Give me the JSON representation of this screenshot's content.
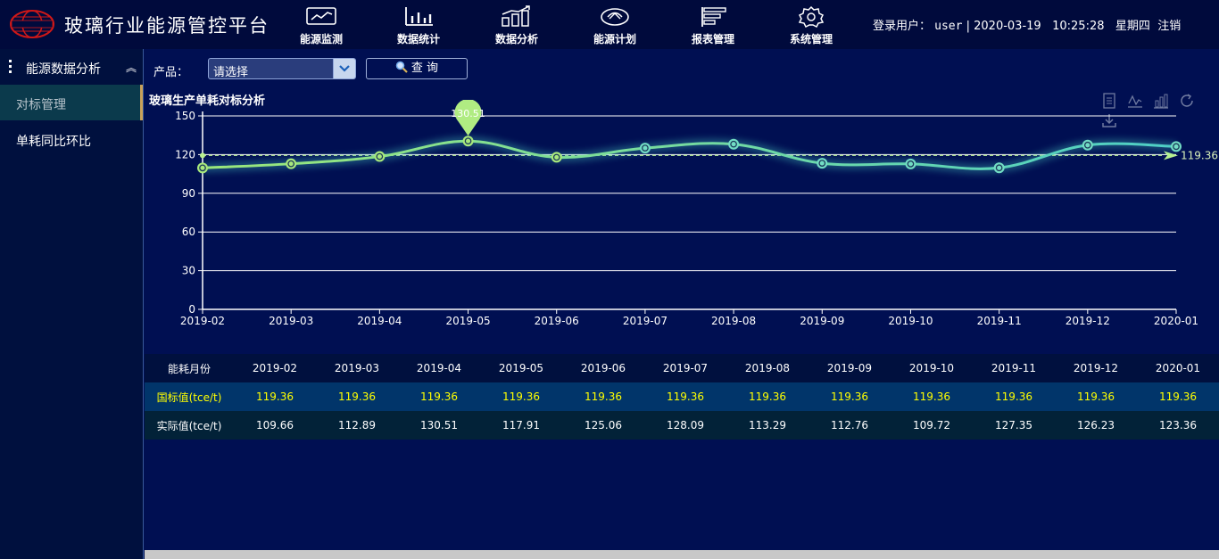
{
  "app": {
    "title": "玻璃行业能源管控平台"
  },
  "nav": [
    {
      "label": "能源监测",
      "icon": "monitor-chart-icon"
    },
    {
      "label": "数据统计",
      "icon": "bar-stats-icon"
    },
    {
      "label": "数据分析",
      "icon": "trend-analysis-icon"
    },
    {
      "label": "能源计划",
      "icon": "energy-plan-icon"
    },
    {
      "label": "报表管理",
      "icon": "report-icon"
    },
    {
      "label": "系统管理",
      "icon": "gear-icon"
    }
  ],
  "user_bar": {
    "label": "登录用户：",
    "user": "user",
    "separator": "|",
    "date": "2020-03-19",
    "time": "10:25:28",
    "weekday": "星期四",
    "logout": "注销"
  },
  "sidebar": {
    "title": "能源数据分析",
    "items": [
      {
        "label": "对标管理",
        "active": true
      },
      {
        "label": "单耗同比环比",
        "active": false
      }
    ]
  },
  "toolbar": {
    "product_label": "产品：",
    "product_value": "请选择",
    "query_label": "查 询"
  },
  "chart_data": {
    "type": "line",
    "title": "玻璃生产单耗对标分析",
    "categories": [
      "2019-02",
      "2019-03",
      "2019-04",
      "2019-05",
      "2019-06",
      "2019-07",
      "2019-08",
      "2019-09",
      "2019-10",
      "2019-11",
      "2019-12",
      "2020-01"
    ],
    "series": [
      {
        "values": [
          109.66,
          112.89,
          118.51,
          130.51,
          117.91,
          125.06,
          128.09,
          113.29,
          112.76,
          109.72,
          127.35,
          126.23
        ]
      }
    ],
    "benchmark_line": 119.36,
    "benchmark_label": "119.36",
    "max_label": "130.51",
    "ylim": [
      0,
      150
    ],
    "yticks": [
      0,
      30,
      60,
      90,
      120,
      150
    ],
    "grid": true,
    "colors": {
      "line_start": "#9be77a",
      "line_end": "#4ecfc6",
      "benchmark": "#b9f28f"
    },
    "tools": [
      "data-view-icon",
      "line-chart-icon",
      "bar-chart-icon",
      "refresh-icon",
      "download-icon"
    ]
  },
  "table": {
    "header_label": "能耗月份",
    "months": [
      "2019-02",
      "2019-03",
      "2019-04",
      "2019-05",
      "2019-06",
      "2019-07",
      "2019-08",
      "2019-09",
      "2019-10",
      "2019-11",
      "2019-12",
      "2020-01"
    ],
    "national_label": "国标值(tce/t)",
    "national_values": [
      "119.36",
      "119.36",
      "119.36",
      "119.36",
      "119.36",
      "119.36",
      "119.36",
      "119.36",
      "119.36",
      "119.36",
      "119.36",
      "119.36"
    ],
    "actual_label": "实际值(tce/t)",
    "actual_values": [
      "109.66",
      "112.89",
      "130.51",
      "117.91",
      "125.06",
      "128.09",
      "113.29",
      "112.76",
      "109.72",
      "127.35",
      "126.23",
      "123.36"
    ]
  }
}
